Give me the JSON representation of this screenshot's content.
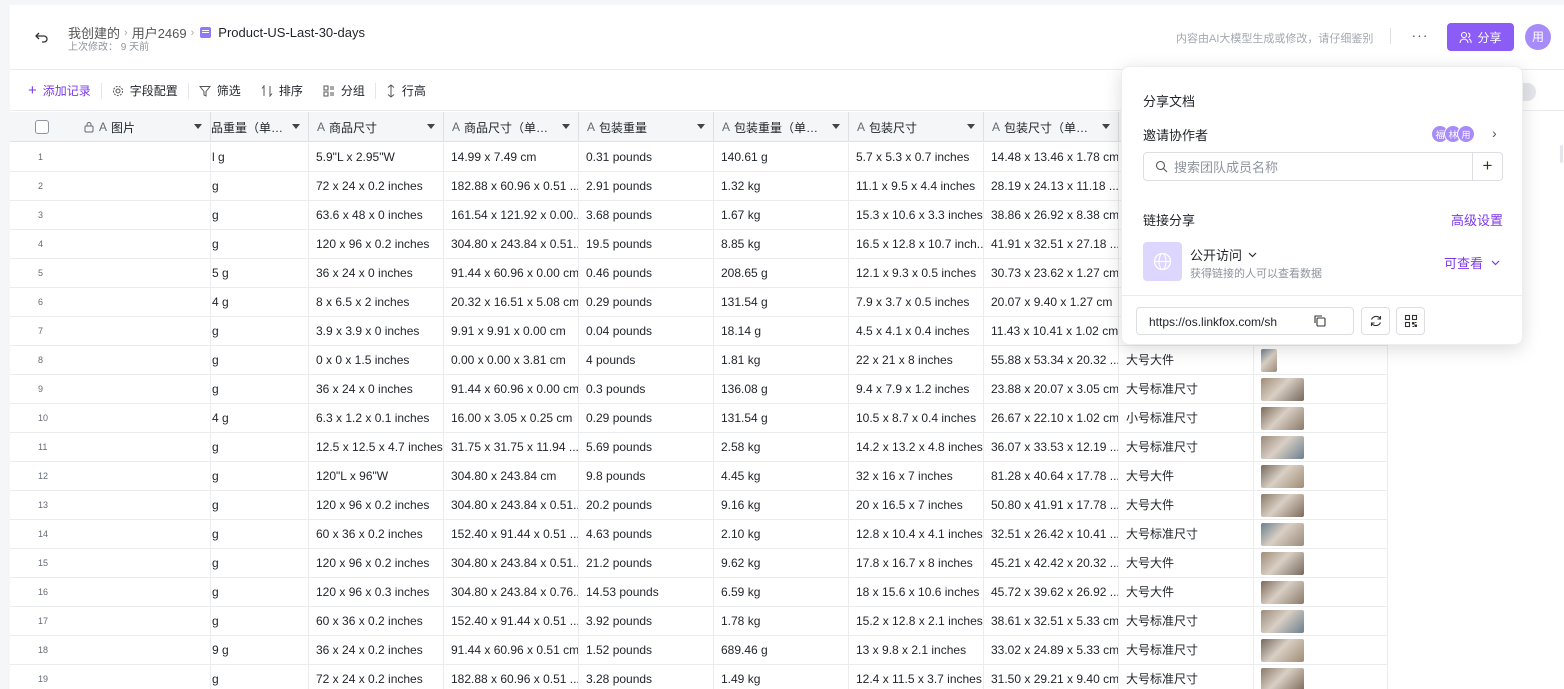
{
  "header": {
    "breadcrumb": [
      "我创建的",
      "用户2469"
    ],
    "doc_title": "Product-US-Last-30-days",
    "last_modified": "上次修改： 9 天前",
    "ai_notice": "内容由AI大模型生成或修改，请仔细鉴别",
    "more": "···",
    "share_label": "分享",
    "avatar": "用"
  },
  "toolbar": {
    "add_record": "添加记录",
    "field_config": "字段配置",
    "filter": "筛选",
    "sort": "排序",
    "group": "分组",
    "row_height": "行高"
  },
  "columns": [
    "图片",
    "品重量（单…",
    "商品尺寸",
    "商品尺寸（单…",
    "包装重量",
    "包装重量（单…",
    "包装尺寸",
    "包装尺寸（单…"
  ],
  "rows": [
    {
      "n": "1",
      "w": "l g",
      "dim": "5.9\"L x 2.95\"W",
      "dim_u": "14.99 x 7.49 cm",
      "pw": "0.31 pounds",
      "pw_u": "140.61 g",
      "pd": "5.7 x 5.3 x 0.7 inches",
      "pd_u": "14.48 x 13.46 x 1.78 cm",
      "size": "",
      "thumb": false
    },
    {
      "n": "2",
      "w": "g",
      "dim": "72 x 24 x 0.2 inches",
      "dim_u": "182.88 x 60.96 x 0.51 ...",
      "pw": "2.91 pounds",
      "pw_u": "1.32 kg",
      "pd": "11.1 x 9.5 x 4.4 inches",
      "pd_u": "28.19 x 24.13 x 11.18 ...",
      "size": "",
      "thumb": false
    },
    {
      "n": "3",
      "w": "g",
      "dim": "63.6 x 48 x 0 inches",
      "dim_u": "161.54 x 121.92 x 0.00...",
      "pw": "3.68 pounds",
      "pw_u": "1.67 kg",
      "pd": "15.3 x 10.6 x 3.3 inches",
      "pd_u": "38.86 x 26.92 x 8.38 cm",
      "size": "",
      "thumb": false
    },
    {
      "n": "4",
      "w": "g",
      "dim": "120 x 96 x 0.2 inches",
      "dim_u": "304.80 x 243.84 x 0.51...",
      "pw": "19.5 pounds",
      "pw_u": "8.85 kg",
      "pd": "16.5 x 12.8 x 10.7 inch...",
      "pd_u": "41.91 x 32.51 x 27.18 ...",
      "size": "",
      "thumb": false
    },
    {
      "n": "5",
      "w": "5 g",
      "dim": "36 x 24 x 0 inches",
      "dim_u": "91.44 x 60.96 x 0.00 cm",
      "pw": "0.46 pounds",
      "pw_u": "208.65 g",
      "pd": "12.1 x 9.3 x 0.5 inches",
      "pd_u": "30.73 x 23.62 x 1.27 cm",
      "size": "",
      "thumb": false
    },
    {
      "n": "6",
      "w": "4 g",
      "dim": "8 x 6.5 x 2 inches",
      "dim_u": "20.32 x 16.51 x 5.08 cm",
      "pw": "0.29 pounds",
      "pw_u": "131.54 g",
      "pd": "7.9 x 3.7 x 0.5 inches",
      "pd_u": "20.07 x 9.40 x 1.27 cm",
      "size": "",
      "thumb": false
    },
    {
      "n": "7",
      "w": "g",
      "dim": "3.9 x 3.9 x 0 inches",
      "dim_u": "9.91 x 9.91 x 0.00 cm",
      "pw": "0.04 pounds",
      "pw_u": "18.14 g",
      "pd": "4.5 x 4.1 x 0.4 inches",
      "pd_u": "11.43 x 10.41 x 1.02 cm",
      "size": "",
      "thumb": false
    },
    {
      "n": "8",
      "w": "g",
      "dim": "0 x 0 x 1.5 inches",
      "dim_u": "0.00 x 0.00 x 3.81 cm",
      "pw": "4 pounds",
      "pw_u": "1.81 kg",
      "pd": "22 x 21 x 8 inches",
      "pd_u": "55.88 x 53.34 x 20.32 ...",
      "size": "大号大件",
      "thumb": true
    },
    {
      "n": "9",
      "w": "g",
      "dim": "36 x 24 x 0 inches",
      "dim_u": "91.44 x 60.96 x 0.00 cm",
      "pw": "0.3 pounds",
      "pw_u": "136.08 g",
      "pd": "9.4 x 7.9 x 1.2 inches",
      "pd_u": "23.88 x 20.07 x 3.05 cm",
      "size": "大号标准尺寸",
      "thumb": true
    },
    {
      "n": "10",
      "w": "4 g",
      "dim": "6.3 x 1.2 x 0.1 inches",
      "dim_u": "16.00 x 3.05 x 0.25 cm",
      "pw": "0.29 pounds",
      "pw_u": "131.54 g",
      "pd": "10.5 x 8.7 x 0.4 inches",
      "pd_u": "26.67 x 22.10 x 1.02 cm",
      "size": "小号标准尺寸",
      "thumb": true
    },
    {
      "n": "11",
      "w": "g",
      "dim": "12.5 x 12.5 x 4.7 inches",
      "dim_u": "31.75 x 31.75 x 11.94 ...",
      "pw": "5.69 pounds",
      "pw_u": "2.58 kg",
      "pd": "14.2 x 13.2 x 4.8 inches",
      "pd_u": "36.07 x 33.53 x 12.19 ...",
      "size": "大号标准尺寸",
      "thumb": true
    },
    {
      "n": "12",
      "w": "g",
      "dim": "120\"L x 96\"W",
      "dim_u": "304.80 x 243.84 cm",
      "pw": "9.8 pounds",
      "pw_u": "4.45 kg",
      "pd": "32 x 16 x 7 inches",
      "pd_u": "81.28 x 40.64 x 17.78 ...",
      "size": "大号大件",
      "thumb": true
    },
    {
      "n": "13",
      "w": "g",
      "dim": "120 x 96 x 0.2 inches",
      "dim_u": "304.80 x 243.84 x 0.51...",
      "pw": "20.2 pounds",
      "pw_u": "9.16 kg",
      "pd": "20 x 16.5 x 7 inches",
      "pd_u": "50.80 x 41.91 x 17.78 ...",
      "size": "大号大件",
      "thumb": true
    },
    {
      "n": "14",
      "w": "g",
      "dim": "60 x 36 x 0.2 inches",
      "dim_u": "152.40 x 91.44 x 0.51 ...",
      "pw": "4.63 pounds",
      "pw_u": "2.10 kg",
      "pd": "12.8 x 10.4 x 4.1 inches",
      "pd_u": "32.51 x 26.42 x 10.41 ...",
      "size": "大号标准尺寸",
      "thumb": true
    },
    {
      "n": "15",
      "w": "g",
      "dim": "120 x 96 x 0.2 inches",
      "dim_u": "304.80 x 243.84 x 0.51...",
      "pw": "21.2 pounds",
      "pw_u": "9.62 kg",
      "pd": "17.8 x 16.7 x 8 inches",
      "pd_u": "45.21 x 42.42 x 20.32 ...",
      "size": "大号大件",
      "thumb": true
    },
    {
      "n": "16",
      "w": "g",
      "dim": "120 x 96 x 0.3 inches",
      "dim_u": "304.80 x 243.84 x 0.76...",
      "pw": "14.53 pounds",
      "pw_u": "6.59 kg",
      "pd": "18 x 15.6 x 10.6 inches",
      "pd_u": "45.72 x 39.62 x 26.92 ...",
      "size": "大号大件",
      "thumb": true
    },
    {
      "n": "17",
      "w": "g",
      "dim": "60 x 36 x 0.2 inches",
      "dim_u": "152.40 x 91.44 x 0.51 ...",
      "pw": "3.92 pounds",
      "pw_u": "1.78 kg",
      "pd": "15.2 x 12.8 x 2.1 inches",
      "pd_u": "38.61 x 32.51 x 5.33 cm",
      "size": "大号标准尺寸",
      "thumb": true
    },
    {
      "n": "18",
      "w": "9 g",
      "dim": "36 x 24 x 0.2 inches",
      "dim_u": "91.44 x 60.96 x 0.51 cm",
      "pw": "1.52 pounds",
      "pw_u": "689.46 g",
      "pd": "13 x 9.8 x 2.1 inches",
      "pd_u": "33.02 x 24.89 x 5.33 cm",
      "size": "大号标准尺寸",
      "thumb": true
    },
    {
      "n": "19",
      "w": "g",
      "dim": "72 x 24 x 0.2 inches",
      "dim_u": "182.88 x 60.96 x 0.51 ...",
      "pw": "3.28 pounds",
      "pw_u": "1.49 kg",
      "pd": "12.4 x 11.5 x 3.7 inches",
      "pd_u": "31.50 x 29.21 x 9.40 cm",
      "size": "大号标准尺寸",
      "thumb": true
    }
  ],
  "share_panel": {
    "title": "分享文档",
    "invite_label": "邀请协作者",
    "collaborators": [
      "福",
      "林",
      "用"
    ],
    "search_placeholder": "搜索团队成员名称",
    "link_share_label": "链接分享",
    "advanced_settings": "高级设置",
    "public_access": "公开访问",
    "public_desc": "获得链接的人可以查看数据",
    "permission": "可查看",
    "url": "https://os.linkfox.com/sh"
  },
  "colors": {
    "accent": "#8b5cf6",
    "accent_text": "#7c3aed"
  }
}
